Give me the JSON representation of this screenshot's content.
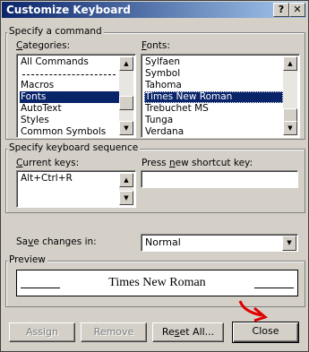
{
  "window": {
    "title": "Customize Keyboard"
  },
  "titlebar_buttons": {
    "help": "?",
    "close": "✕"
  },
  "command_group": {
    "label": "Specify a command",
    "categories": {
      "label": "Categories:",
      "items": [
        "All Commands",
        "",
        "Macros",
        "Fonts",
        "AutoText",
        "Styles",
        "Common Symbols"
      ],
      "selected": "Fonts"
    },
    "fonts": {
      "label": "Fonts:",
      "items": [
        "Sylfaen",
        "Symbol",
        "Tahoma",
        "Times New Roman",
        "Trebuchet MS",
        "Tunga",
        "Verdana"
      ],
      "selected": "Times New Roman"
    }
  },
  "keyboard_group": {
    "label": "Specify keyboard sequence",
    "current_keys_label": "Current keys:",
    "current_keys": [
      "Alt+Ctrl+R"
    ],
    "new_shortcut_label": "Press new shortcut key:",
    "new_shortcut_value": ""
  },
  "save_changes": {
    "label": "Save changes in:",
    "value": "Normal"
  },
  "preview": {
    "label": "Preview",
    "text": "Times New Roman"
  },
  "buttons": {
    "assign": "Assign",
    "remove": "Remove",
    "reset_all": "Reset All...",
    "close": "Close"
  },
  "annotation": {
    "arrow_color": "#e00000"
  },
  "colors": {
    "selection": "#0a246a",
    "title_start": "#0a246a",
    "title_end": "#a6caf0"
  }
}
